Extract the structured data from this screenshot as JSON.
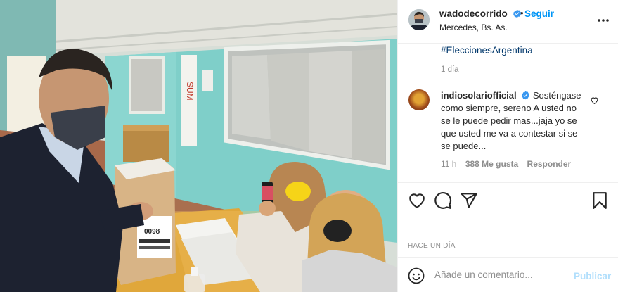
{
  "post": {
    "author": {
      "username": "wadodecorrido",
      "verified": true,
      "follow_label": "Seguir",
      "location": "Mercedes, Bs. As."
    },
    "caption_hashtag": "#EleccionesArgentina",
    "caption_time": "1 día",
    "comment": {
      "username": "indiosolariofficial",
      "verified": true,
      "text": "Sosténgase como siempre, sereno A usted no se le puede pedir mas...jaja yo se que usted me va a contestar si se se puede...",
      "time": "11 h",
      "likes": "388 Me gusta",
      "reply_label": "Responder"
    },
    "date": "HACE UN DÍA",
    "add_comment": {
      "placeholder": "Añade un comentario...",
      "publish_label": "Publicar"
    },
    "photo_text": {
      "ballot_number": "0098",
      "poster_text": "SUM"
    },
    "icons": {
      "more": "more-options-icon",
      "like": "heart-icon",
      "comment": "comment-icon",
      "share": "share-icon",
      "save": "bookmark-icon",
      "emoji": "emoji-icon",
      "verified": "verified-badge-icon"
    },
    "colors": {
      "link": "#0095f6",
      "hashtag": "#00376b",
      "muted": "#8e8e8e",
      "publish_disabled": "#b2dffc"
    }
  }
}
